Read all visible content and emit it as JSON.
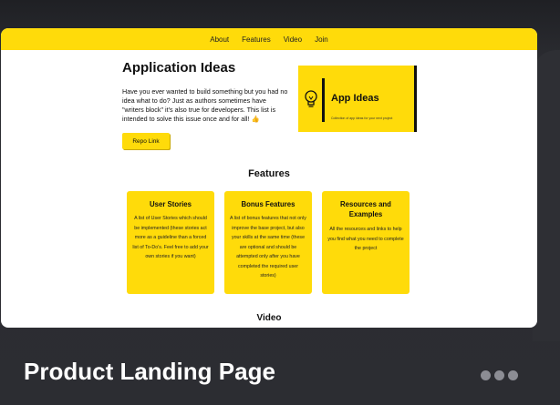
{
  "nav": {
    "items": [
      "About",
      "Features",
      "Video",
      "Join"
    ]
  },
  "hero": {
    "title": "Application Ideas",
    "text": "Have you ever wanted to build something but you had no idea what to do? Just as authors sometimes have \"writers block\" it's also true for developers. This list is intended to solve this issue once and for all! 👍",
    "button_label": "Repo Link",
    "image": {
      "title": "App Ideas",
      "subtitle": "Collection of app ideas for your next project"
    }
  },
  "features": {
    "heading": "Features",
    "cards": [
      {
        "title": "User Stories",
        "text": "A list of User Stories which should be implemented (these stories act more as a guideline than a forced list of To-Do's. Feel free to add your own stories if you want)"
      },
      {
        "title": "Bonus Features",
        "text": "A list of bonus features that not only improve the base project, but also your skills at the same time (these are optional and should be attempted only after you have completed the required user stories)"
      },
      {
        "title": "Resources and Examples",
        "text": "All the resources and links to help you find what you need to complete the project"
      }
    ]
  },
  "video": {
    "heading": "Video"
  },
  "card": {
    "title": "Product Landing Page",
    "more_icon": "more-dots-icon"
  },
  "colors": {
    "accent": "#ffdb0a",
    "background": "#1c1d21",
    "dot": "#8c8d94"
  }
}
